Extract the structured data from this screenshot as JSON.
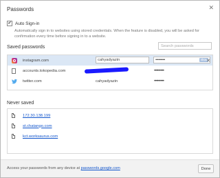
{
  "dialog": {
    "title": "Passwords",
    "close_glyph": "✕"
  },
  "auto_signin": {
    "label": "Auto Sign-in",
    "checked": true,
    "check_glyph": "✔",
    "description": "Automatically sign in to websites using stored credentials. When the feature is disabled, you will be asked for confirmation every time before signing in to a website."
  },
  "saved_passwords": {
    "title": "Saved passwords",
    "search_placeholder": "Search passwords",
    "rows": [
      {
        "site": "instagram.com",
        "username": "cahyadyazin",
        "password": "•••••••••",
        "show_label": "Show",
        "remove_glyph": "✕",
        "icon": "instagram-icon"
      },
      {
        "site": "accounts.tokopedia.com",
        "username": "",
        "password": "•••••••••",
        "icon": "page-icon"
      },
      {
        "site": "twitter.com",
        "username": "cahyadyazin",
        "password": "•••••••••",
        "icon": "twitter-icon"
      }
    ]
  },
  "never_saved": {
    "title": "Never saved",
    "rows": [
      {
        "site": "172.30.138.199"
      },
      {
        "site": "st.chatango.com"
      },
      {
        "site": "kct.worksaurus.com"
      }
    ]
  },
  "footer": {
    "text": "Access your passwords from any device at ",
    "link": "passwords.google.com",
    "done_label": "Done"
  }
}
